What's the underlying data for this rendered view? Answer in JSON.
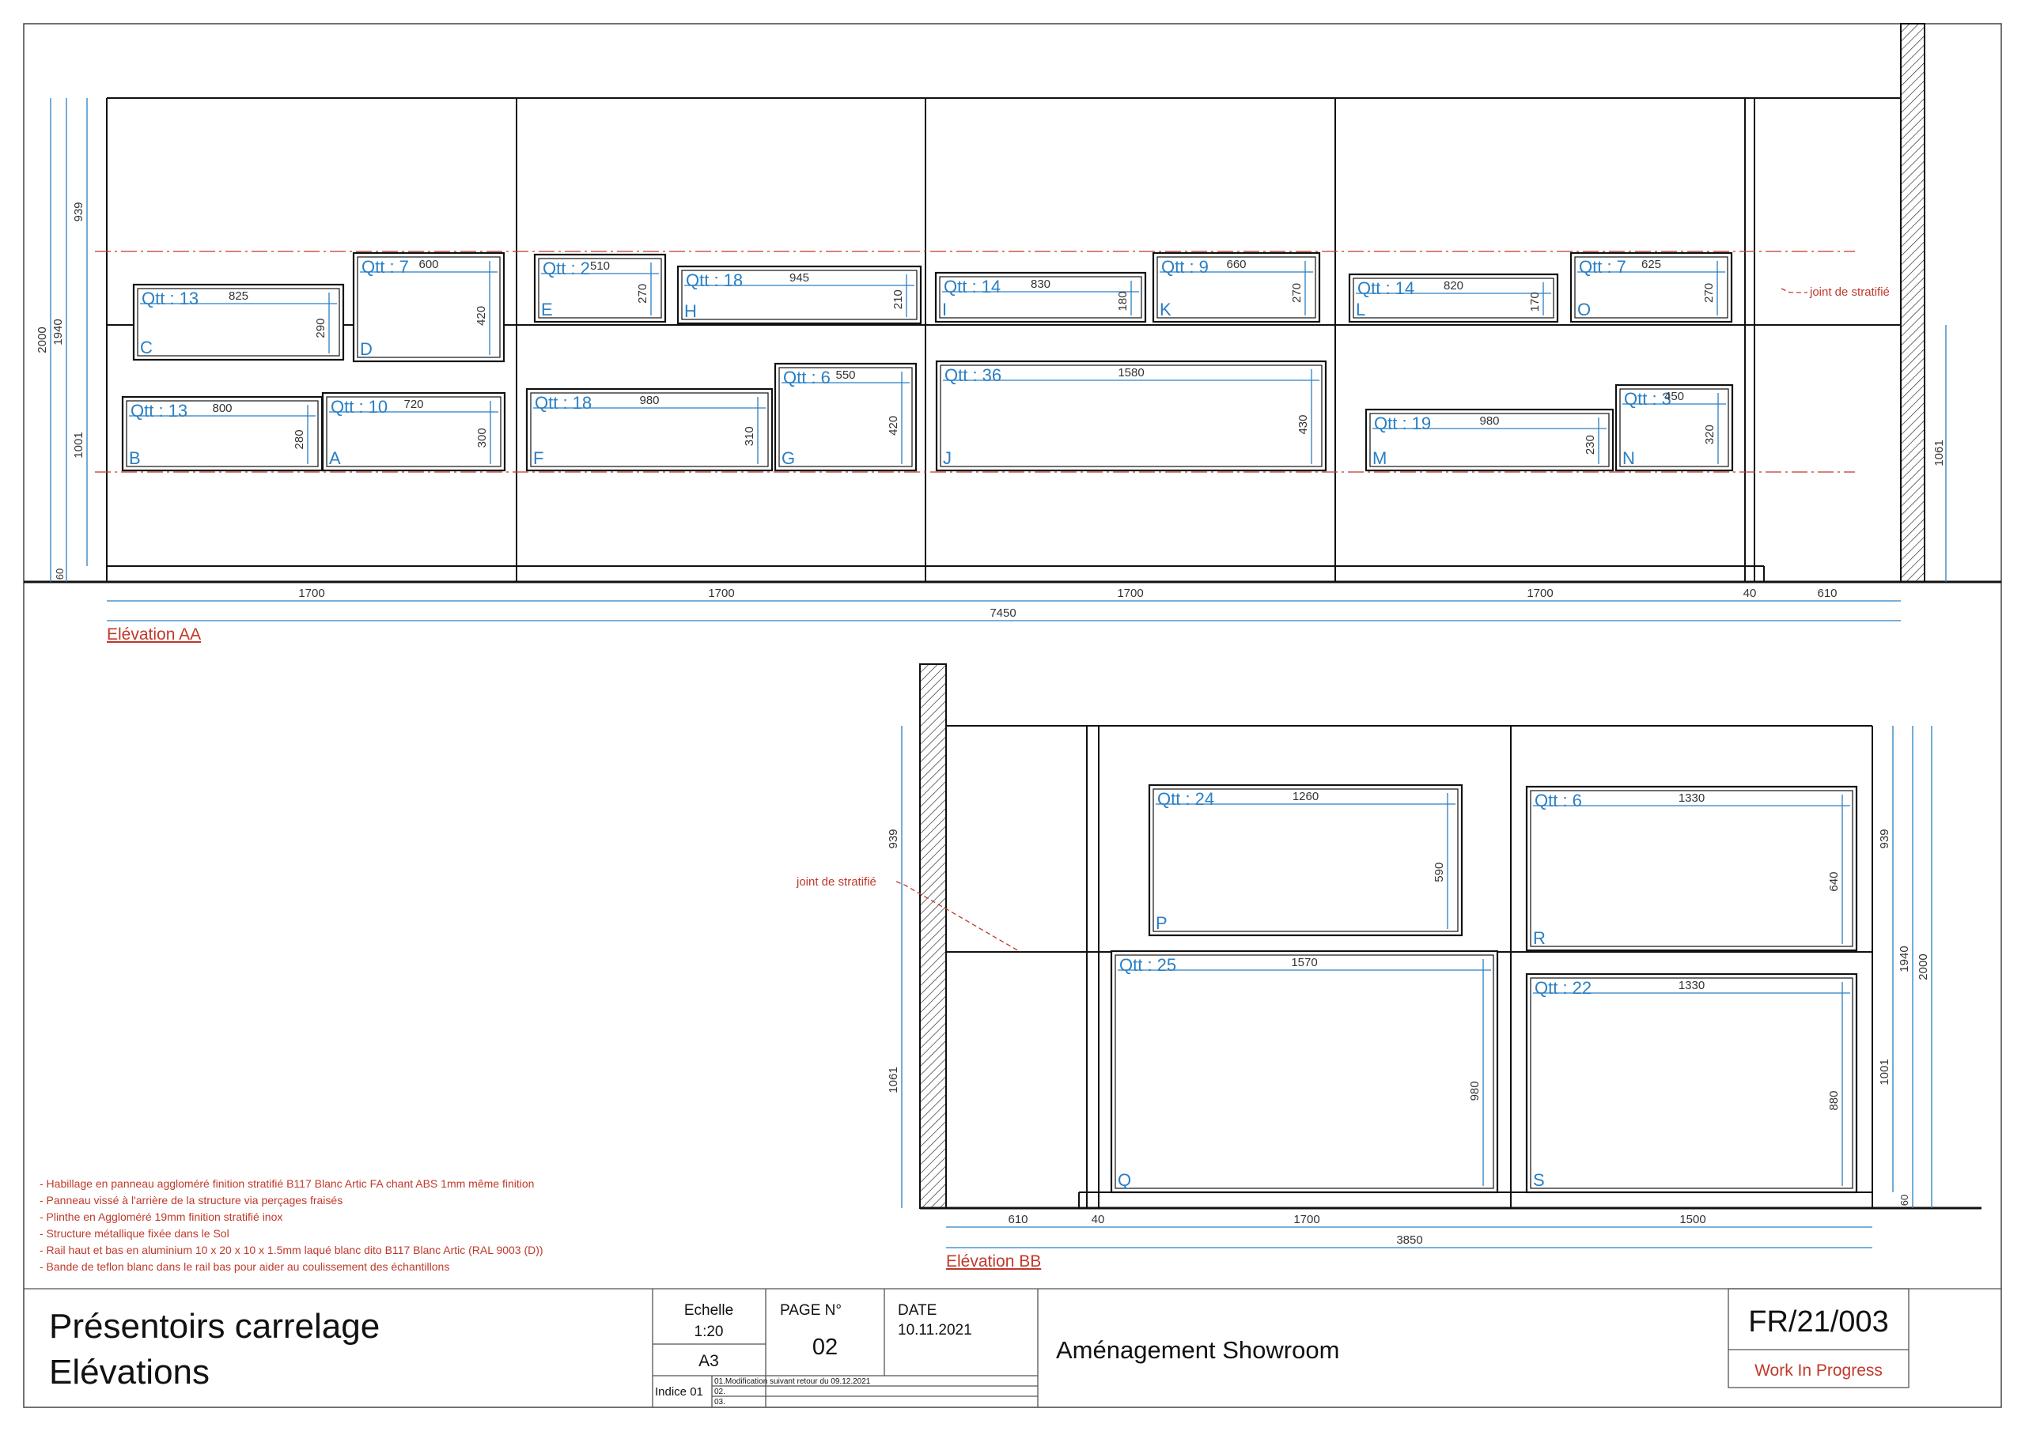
{
  "elevation_aa": {
    "title": "Elévation AA",
    "joint_label": "joint de stratifié",
    "left_dims": [
      "2000",
      "1940",
      "939",
      "1001",
      "60"
    ],
    "right_dim": "1061",
    "bottom_dims": [
      "1700",
      "1700",
      "1700",
      "1700",
      "40",
      "610"
    ],
    "total_dim": "7450",
    "panels": [
      {
        "letter": "C",
        "qtt": "Qtt : 13",
        "w": "825",
        "h": "290"
      },
      {
        "letter": "D",
        "qtt": "Qtt : 7",
        "w": "600",
        "h": "420"
      },
      {
        "letter": "B",
        "qtt": "Qtt : 13",
        "w": "800",
        "h": "280"
      },
      {
        "letter": "A",
        "qtt": "Qtt : 10",
        "w": "720",
        "h": "300"
      },
      {
        "letter": "E",
        "qtt": "Qtt : 2",
        "w": "510",
        "h": "270"
      },
      {
        "letter": "H",
        "qtt": "Qtt : 18",
        "w": "945",
        "h": "210"
      },
      {
        "letter": "F",
        "qtt": "Qtt : 18",
        "w": "980",
        "h": "310"
      },
      {
        "letter": "G",
        "qtt": "Qtt : 6",
        "w": "550",
        "h": "420"
      },
      {
        "letter": "I",
        "qtt": "Qtt : 14",
        "w": "830",
        "h": "180"
      },
      {
        "letter": "K",
        "qtt": "Qtt : 9",
        "w": "660",
        "h": "270"
      },
      {
        "letter": "J",
        "qtt": "Qtt : 36",
        "w": "1580",
        "h": "430"
      },
      {
        "letter": "L",
        "qtt": "Qtt : 14",
        "w": "820",
        "h": "170"
      },
      {
        "letter": "O",
        "qtt": "Qtt : 7",
        "w": "625",
        "h": "270"
      },
      {
        "letter": "M",
        "qtt": "Qtt : 19",
        "w": "980",
        "h": "230"
      },
      {
        "letter": "N",
        "qtt": "Qtt : 3",
        "w": "450",
        "h": "320"
      }
    ]
  },
  "elevation_bb": {
    "title": "Elévation BB",
    "joint_label": "joint de stratifié",
    "left_dims": [
      "939",
      "1061"
    ],
    "right_dims": [
      "939",
      "1001",
      "1940",
      "2000",
      "60"
    ],
    "bottom_dims": [
      "610",
      "40",
      "1700",
      "1500"
    ],
    "total_dim": "3850",
    "panels": [
      {
        "letter": "P",
        "qtt": "Qtt : 24",
        "w": "1260",
        "h": "590"
      },
      {
        "letter": "R",
        "qtt": "Qtt : 6",
        "w": "1330",
        "h": "640"
      },
      {
        "letter": "Q",
        "qtt": "Qtt : 25",
        "w": "1570",
        "h": "980"
      },
      {
        "letter": "S",
        "qtt": "Qtt : 22",
        "w": "1330",
        "h": "880"
      }
    ]
  },
  "notes": [
    "- Habillage en panneau aggloméré finition stratifié B117 Blanc Artic FA chant ABS 1mm même finition",
    "- Panneau vissé à l'arrière de la structure via perçages fraisés",
    "- Plinthe en Aggloméré 19mm finition stratifié inox",
    "- Structure métallique fixée dans le Sol",
    "- Rail haut et bas en aluminium 10 x 20 x 10 x 1.5mm laqué blanc dito B117 Blanc Artic (RAL 9003 (D))",
    "- Bande de teflon blanc dans le rail bas pour aider au coulissement des échantillons"
  ],
  "title_block": {
    "title_line1": "Présentoirs carrelage",
    "title_line2": "Elévations",
    "echelle_label": "Echelle",
    "echelle_value": "1:20",
    "format": "A3",
    "indice_label": "Indice 01",
    "revisions": [
      "01.Modification suivant retour du 09.12.2021",
      "02.",
      "03."
    ],
    "page_label": "PAGE N°",
    "page_value": "02",
    "date_label": "DATE",
    "date_value": "10.11.2021",
    "project": "Aménagement Showroom",
    "reference": "FR/21/003",
    "status": "Work In Progress"
  },
  "colors": {
    "dimension_blue": "#2a7fc4",
    "annotation_red": "#c0392b",
    "line": "#111111"
  }
}
